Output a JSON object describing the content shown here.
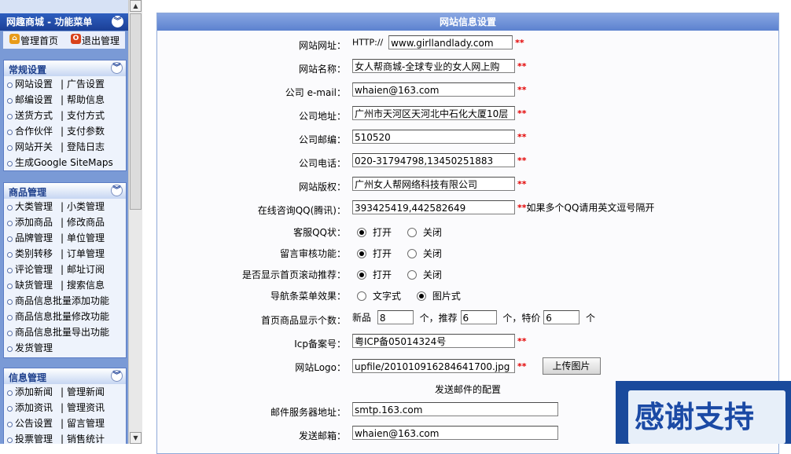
{
  "sidebar": {
    "title": "网趣商城 - 功能菜单",
    "home_label": "管理首页",
    "logout_label": "退出管理",
    "sections": [
      {
        "title": "常规设置",
        "rows": [
          [
            "网站设置",
            "广告设置"
          ],
          [
            "邮编设置",
            "帮助信息"
          ],
          [
            "送货方式",
            "支付方式"
          ],
          [
            "合作伙伴",
            "支付参数"
          ],
          [
            "网站开关",
            "登陆日志"
          ],
          [
            "生成Google SiteMaps"
          ]
        ]
      },
      {
        "title": "商品管理",
        "rows": [
          [
            "大类管理",
            "小类管理"
          ],
          [
            "添加商品",
            "修改商品"
          ],
          [
            "品牌管理",
            "单位管理"
          ],
          [
            "类别转移",
            "订单管理"
          ],
          [
            "评论管理",
            "邮址订阅"
          ],
          [
            "缺货管理",
            "搜索信息"
          ],
          [
            "商品信息批量添加功能"
          ],
          [
            "商品信息批量修改功能"
          ],
          [
            "商品信息批量导出功能"
          ],
          [
            "发货管理"
          ]
        ]
      },
      {
        "title": "信息管理",
        "rows": [
          [
            "添加新闻",
            "管理新闻"
          ],
          [
            "添加资讯",
            "管理资讯"
          ],
          [
            "公告设置",
            "留言管理"
          ],
          [
            "投票管理",
            "销售统计"
          ]
        ]
      }
    ]
  },
  "form": {
    "title": "网站信息设置",
    "site_url_label": "网站网址：",
    "site_url_prefix": "HTTP://",
    "site_url_value": "www.girllandlady.com",
    "site_name_label": "网站名称：",
    "site_name_value": "女人帮商城-全球专业的女人网上购",
    "email_label": "公司 e-mail：",
    "email_value": "whaien@163.com",
    "address_label": "公司地址：",
    "address_value": "广州市天河区天河北中石化大厦10层",
    "postcode_label": "公司邮编：",
    "postcode_value": "510520",
    "phone_label": "公司电话：",
    "phone_value": "020-31794798,13450251883",
    "copyright_label": "网站版权：",
    "copyright_value": "广州女人帮网络科技有限公司",
    "qq_label": "在线咨询QQ(腾讯)：",
    "qq_value": "393425419,442582649",
    "qq_hint": "如果多个QQ请用英文逗号隔开",
    "kefu_label": "客服QQ状：",
    "guestbook_label": "留言审核功能：",
    "scroll_label": "是否显示首页滚动推荐：",
    "on_label": "打开",
    "off_label": "关闭",
    "nav_label": "导航条菜单效果：",
    "nav_text_label": "文字式",
    "nav_image_label": "图片式",
    "home_count_label": "首页商品显示个数：",
    "new_label": "新品",
    "new_value": "8",
    "rec_label": "个，推荐",
    "rec_value": "6",
    "special_label": "个，特价",
    "special_value": "6",
    "unit_label": "个",
    "icp_label": "Icp备案号：",
    "icp_value": "粤ICP备05014324号",
    "logo_label": "网站Logo：",
    "logo_value": "upfile/201010916284641700.jpg",
    "upload_label": "上传图片",
    "mail_section": "发送邮件的配置",
    "smtp_label": "邮件服务器地址：",
    "smtp_value": "smtp.163.com",
    "sender_label": "发送邮箱：",
    "sender_value": "whaien@163.com",
    "required_mark": "**"
  },
  "banner": {
    "text": "感谢支持"
  },
  "colors": {
    "menu_header": "#1b3f96",
    "section_title": "#1d3f8c",
    "required": "#e30000",
    "panel_title": "#5c82cf"
  }
}
